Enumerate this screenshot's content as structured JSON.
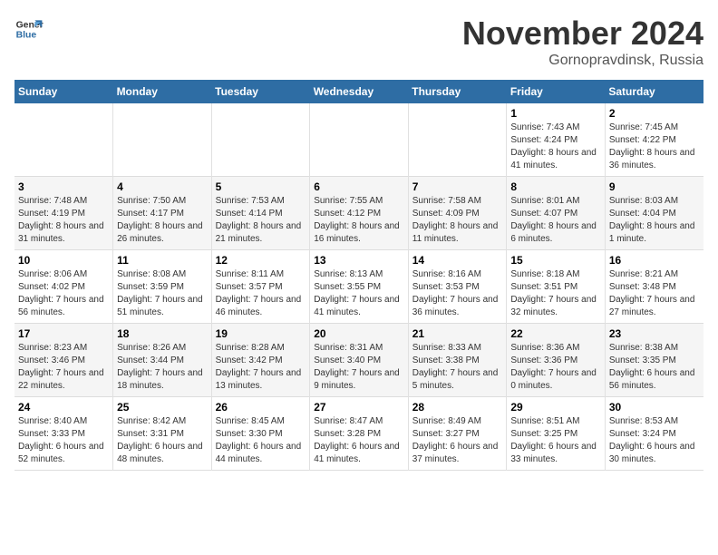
{
  "logo": {
    "line1": "General",
    "line2": "Blue"
  },
  "header": {
    "month": "November 2024",
    "location": "Gornopravdinsk, Russia"
  },
  "days_of_week": [
    "Sunday",
    "Monday",
    "Tuesday",
    "Wednesday",
    "Thursday",
    "Friday",
    "Saturday"
  ],
  "weeks": [
    [
      {
        "day": "",
        "info": ""
      },
      {
        "day": "",
        "info": ""
      },
      {
        "day": "",
        "info": ""
      },
      {
        "day": "",
        "info": ""
      },
      {
        "day": "",
        "info": ""
      },
      {
        "day": "1",
        "info": "Sunrise: 7:43 AM\nSunset: 4:24 PM\nDaylight: 8 hours and 41 minutes."
      },
      {
        "day": "2",
        "info": "Sunrise: 7:45 AM\nSunset: 4:22 PM\nDaylight: 8 hours and 36 minutes."
      }
    ],
    [
      {
        "day": "3",
        "info": "Sunrise: 7:48 AM\nSunset: 4:19 PM\nDaylight: 8 hours and 31 minutes."
      },
      {
        "day": "4",
        "info": "Sunrise: 7:50 AM\nSunset: 4:17 PM\nDaylight: 8 hours and 26 minutes."
      },
      {
        "day": "5",
        "info": "Sunrise: 7:53 AM\nSunset: 4:14 PM\nDaylight: 8 hours and 21 minutes."
      },
      {
        "day": "6",
        "info": "Sunrise: 7:55 AM\nSunset: 4:12 PM\nDaylight: 8 hours and 16 minutes."
      },
      {
        "day": "7",
        "info": "Sunrise: 7:58 AM\nSunset: 4:09 PM\nDaylight: 8 hours and 11 minutes."
      },
      {
        "day": "8",
        "info": "Sunrise: 8:01 AM\nSunset: 4:07 PM\nDaylight: 8 hours and 6 minutes."
      },
      {
        "day": "9",
        "info": "Sunrise: 8:03 AM\nSunset: 4:04 PM\nDaylight: 8 hours and 1 minute."
      }
    ],
    [
      {
        "day": "10",
        "info": "Sunrise: 8:06 AM\nSunset: 4:02 PM\nDaylight: 7 hours and 56 minutes."
      },
      {
        "day": "11",
        "info": "Sunrise: 8:08 AM\nSunset: 3:59 PM\nDaylight: 7 hours and 51 minutes."
      },
      {
        "day": "12",
        "info": "Sunrise: 8:11 AM\nSunset: 3:57 PM\nDaylight: 7 hours and 46 minutes."
      },
      {
        "day": "13",
        "info": "Sunrise: 8:13 AM\nSunset: 3:55 PM\nDaylight: 7 hours and 41 minutes."
      },
      {
        "day": "14",
        "info": "Sunrise: 8:16 AM\nSunset: 3:53 PM\nDaylight: 7 hours and 36 minutes."
      },
      {
        "day": "15",
        "info": "Sunrise: 8:18 AM\nSunset: 3:51 PM\nDaylight: 7 hours and 32 minutes."
      },
      {
        "day": "16",
        "info": "Sunrise: 8:21 AM\nSunset: 3:48 PM\nDaylight: 7 hours and 27 minutes."
      }
    ],
    [
      {
        "day": "17",
        "info": "Sunrise: 8:23 AM\nSunset: 3:46 PM\nDaylight: 7 hours and 22 minutes."
      },
      {
        "day": "18",
        "info": "Sunrise: 8:26 AM\nSunset: 3:44 PM\nDaylight: 7 hours and 18 minutes."
      },
      {
        "day": "19",
        "info": "Sunrise: 8:28 AM\nSunset: 3:42 PM\nDaylight: 7 hours and 13 minutes."
      },
      {
        "day": "20",
        "info": "Sunrise: 8:31 AM\nSunset: 3:40 PM\nDaylight: 7 hours and 9 minutes."
      },
      {
        "day": "21",
        "info": "Sunrise: 8:33 AM\nSunset: 3:38 PM\nDaylight: 7 hours and 5 minutes."
      },
      {
        "day": "22",
        "info": "Sunrise: 8:36 AM\nSunset: 3:36 PM\nDaylight: 7 hours and 0 minutes."
      },
      {
        "day": "23",
        "info": "Sunrise: 8:38 AM\nSunset: 3:35 PM\nDaylight: 6 hours and 56 minutes."
      }
    ],
    [
      {
        "day": "24",
        "info": "Sunrise: 8:40 AM\nSunset: 3:33 PM\nDaylight: 6 hours and 52 minutes."
      },
      {
        "day": "25",
        "info": "Sunrise: 8:42 AM\nSunset: 3:31 PM\nDaylight: 6 hours and 48 minutes."
      },
      {
        "day": "26",
        "info": "Sunrise: 8:45 AM\nSunset: 3:30 PM\nDaylight: 6 hours and 44 minutes."
      },
      {
        "day": "27",
        "info": "Sunrise: 8:47 AM\nSunset: 3:28 PM\nDaylight: 6 hours and 41 minutes."
      },
      {
        "day": "28",
        "info": "Sunrise: 8:49 AM\nSunset: 3:27 PM\nDaylight: 6 hours and 37 minutes."
      },
      {
        "day": "29",
        "info": "Sunrise: 8:51 AM\nSunset: 3:25 PM\nDaylight: 6 hours and 33 minutes."
      },
      {
        "day": "30",
        "info": "Sunrise: 8:53 AM\nSunset: 3:24 PM\nDaylight: 6 hours and 30 minutes."
      }
    ]
  ]
}
